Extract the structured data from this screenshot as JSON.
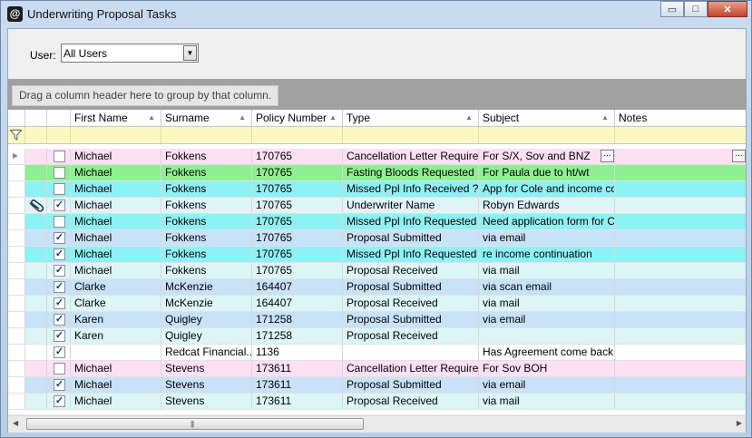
{
  "window": {
    "title": "Underwriting Proposal Tasks",
    "minimize": "▭",
    "maximize": "□",
    "close": "✕"
  },
  "filter": {
    "user_label": "User:",
    "user_value": "All Users"
  },
  "group_panel": {
    "hint": "Drag a column header here to group by that column."
  },
  "columns": [
    "First Name",
    "Surname",
    "Policy Number",
    "Type",
    "Subject",
    "Notes"
  ],
  "colors": {
    "pink": "#fde0f4",
    "green": "#8ef08e",
    "cyan": "#8ef1f5",
    "light_cyan": "#dcf5f5",
    "blue": "#c8e2f8",
    "white": "#ffffff",
    "filter_yellow": "#fdf8c3"
  },
  "rows": [
    {
      "first": "Michael",
      "surname": "Fokkens",
      "policy": "170765",
      "type": "Cancellation Letter Required",
      "subject": "For S/X, Sov and BNZ",
      "notes": "",
      "checked": false,
      "bg": "pink",
      "current": true,
      "attachment": false
    },
    {
      "first": "Michael",
      "surname": "Fokkens",
      "policy": "170765",
      "type": "Fasting Bloods Requested",
      "subject": "For Paula due to ht/wt",
      "notes": "",
      "checked": false,
      "bg": "green",
      "current": false,
      "attachment": false
    },
    {
      "first": "Michael",
      "surname": "Fokkens",
      "policy": "170765",
      "type": "Missed Ppl Info Received ?",
      "subject": "App for Cole and income co...",
      "notes": "",
      "checked": false,
      "bg": "cyan",
      "current": false,
      "attachment": false
    },
    {
      "first": "Michael",
      "surname": "Fokkens",
      "policy": "170765",
      "type": "Underwriter Name",
      "subject": "Robyn Edwards",
      "notes": "",
      "checked": true,
      "bg": "light_cyan",
      "current": false,
      "attachment": true
    },
    {
      "first": "Michael",
      "surname": "Fokkens",
      "policy": "170765",
      "type": "Missed Ppl Info Requested",
      "subject": "Need application form for C...",
      "notes": "",
      "checked": false,
      "bg": "cyan",
      "current": false,
      "attachment": false
    },
    {
      "first": "Michael",
      "surname": "Fokkens",
      "policy": "170765",
      "type": "Proposal Submitted",
      "subject": "via email",
      "notes": "",
      "checked": true,
      "bg": "blue",
      "current": false,
      "attachment": false
    },
    {
      "first": "Michael",
      "surname": "Fokkens",
      "policy": "170765",
      "type": "Missed Ppl Info Requested",
      "subject": "re income continuation",
      "notes": "",
      "checked": true,
      "bg": "cyan",
      "current": false,
      "attachment": false
    },
    {
      "first": "Michael",
      "surname": "Fokkens",
      "policy": "170765",
      "type": "Proposal Received",
      "subject": "via mail",
      "notes": "",
      "checked": true,
      "bg": "light_cyan",
      "current": false,
      "attachment": false
    },
    {
      "first": "Clarke",
      "surname": "McKenzie",
      "policy": "164407",
      "type": "Proposal Submitted",
      "subject": "via scan email",
      "notes": "",
      "checked": true,
      "bg": "blue",
      "current": false,
      "attachment": false
    },
    {
      "first": "Clarke",
      "surname": "McKenzie",
      "policy": "164407",
      "type": "Proposal Received",
      "subject": "via mail",
      "notes": "",
      "checked": true,
      "bg": "light_cyan",
      "current": false,
      "attachment": false
    },
    {
      "first": "Karen",
      "surname": "Quigley",
      "policy": "171258",
      "type": "Proposal Submitted",
      "subject": "via email",
      "notes": "",
      "checked": true,
      "bg": "blue",
      "current": false,
      "attachment": false
    },
    {
      "first": "Karen",
      "surname": "Quigley",
      "policy": "171258",
      "type": "Proposal Received",
      "subject": "",
      "notes": "",
      "checked": true,
      "bg": "light_cyan",
      "current": false,
      "attachment": false
    },
    {
      "first": "",
      "surname": "Redcat Financial...",
      "policy": "1136",
      "type": "",
      "subject": "Has Agreement come back...",
      "notes": "",
      "checked": true,
      "bg": "white",
      "current": false,
      "attachment": false
    },
    {
      "first": "Michael",
      "surname": "Stevens",
      "policy": "173611",
      "type": "Cancellation Letter Required",
      "subject": "For Sov BOH",
      "notes": "",
      "checked": false,
      "bg": "pink",
      "current": false,
      "attachment": false
    },
    {
      "first": "Michael",
      "surname": "Stevens",
      "policy": "173611",
      "type": "Proposal Submitted",
      "subject": "via email",
      "notes": "",
      "checked": true,
      "bg": "blue",
      "current": false,
      "attachment": false
    },
    {
      "first": "Michael",
      "surname": "Stevens",
      "policy": "173611",
      "type": "Proposal Received",
      "subject": "via mail",
      "notes": "",
      "checked": true,
      "bg": "light_cyan",
      "current": false,
      "attachment": false
    }
  ]
}
